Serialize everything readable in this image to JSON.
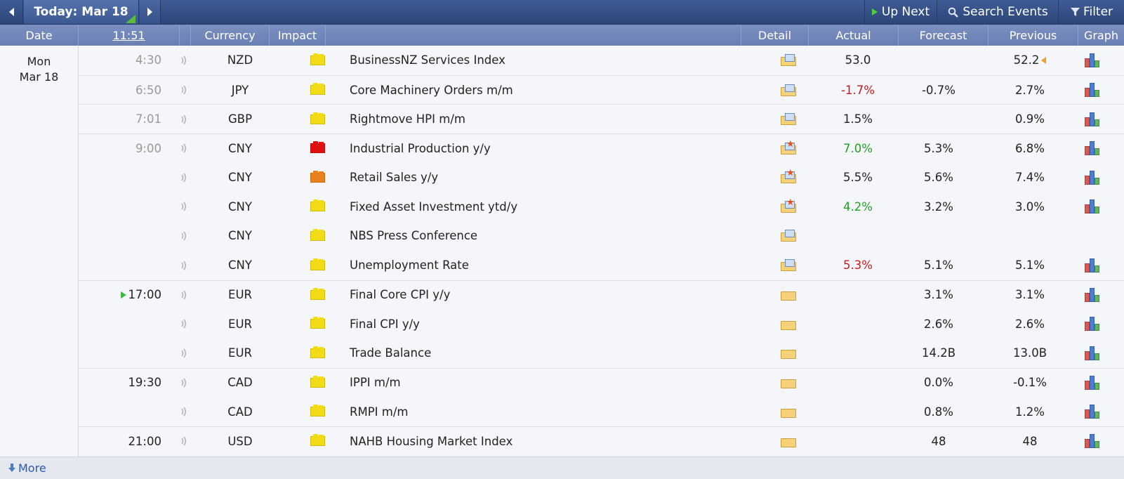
{
  "toolbar": {
    "today_label": "Today: Mar 18",
    "up_next_label": "Up Next",
    "search_label": "Search Events",
    "filter_label": "Filter"
  },
  "header": {
    "date": "Date",
    "time": "11:51",
    "currency": "Currency",
    "impact": "Impact",
    "detail": "Detail",
    "actual": "Actual",
    "forecast": "Forecast",
    "previous": "Previous",
    "graph": "Graph"
  },
  "date_cell": {
    "weekday": "Mon",
    "day": "Mar 18"
  },
  "impact_colors": {
    "low": "#f2dc17",
    "medium": "#e8801e",
    "high": "#e01010"
  },
  "rows": [
    {
      "time": "4:30",
      "currency": "NZD",
      "impact": "low",
      "event": "BusinessNZ Services Index",
      "detail": "folder-doc-icon",
      "actual": "53.0",
      "actual_color": "",
      "forecast": "",
      "previous": "52.2",
      "graph": true
    },
    {
      "time": "6:50",
      "currency": "JPY",
      "impact": "low",
      "event": "Core Machinery Orders m/m",
      "detail": "folder-doc-icon",
      "actual": "-1.7%",
      "actual_color": "red",
      "forecast": "-0.7%",
      "previous": "2.7%",
      "graph": true
    },
    {
      "time": "7:01",
      "currency": "GBP",
      "impact": "low",
      "event": "Rightmove HPI m/m",
      "detail": "folder-doc-icon",
      "actual": "1.5%",
      "actual_color": "",
      "forecast": "",
      "previous": "0.9%",
      "graph": true
    },
    {
      "time": "9:00",
      "currency": "CNY",
      "impact": "high",
      "event": "Industrial Production y/y",
      "detail": "folder-star-icon",
      "actual": "7.0%",
      "actual_color": "green",
      "forecast": "5.3%",
      "previous": "6.8%",
      "graph": true
    },
    {
      "time": "",
      "currency": "CNY",
      "impact": "medium",
      "event": "Retail Sales y/y",
      "detail": "folder-star-icon",
      "actual": "5.5%",
      "actual_color": "",
      "forecast": "5.6%",
      "previous": "7.4%",
      "graph": true
    },
    {
      "time": "",
      "currency": "CNY",
      "impact": "low",
      "event": "Fixed Asset Investment ytd/y",
      "detail": "folder-star-icon",
      "actual": "4.2%",
      "actual_color": "green",
      "forecast": "3.2%",
      "previous": "3.0%",
      "graph": true
    },
    {
      "time": "",
      "currency": "CNY",
      "impact": "low",
      "event": "NBS Press Conference",
      "detail": "folder-doc-icon",
      "actual": "",
      "actual_color": "",
      "forecast": "",
      "previous": "",
      "graph": false
    },
    {
      "time": "",
      "currency": "CNY",
      "impact": "low",
      "event": "Unemployment Rate",
      "detail": "folder-doc-icon",
      "actual": "5.3%",
      "actual_color": "red",
      "forecast": "5.1%",
      "previous": "5.1%",
      "graph": true
    },
    {
      "time": "17:00",
      "currency": "EUR",
      "impact": "low",
      "event": "Final Core CPI y/y",
      "detail": "folder-icon",
      "actual": "",
      "actual_color": "",
      "forecast": "3.1%",
      "previous": "3.1%",
      "graph": true
    },
    {
      "time": "",
      "currency": "EUR",
      "impact": "low",
      "event": "Final CPI y/y",
      "detail": "folder-icon",
      "actual": "",
      "actual_color": "",
      "forecast": "2.6%",
      "previous": "2.6%",
      "graph": true
    },
    {
      "time": "",
      "currency": "EUR",
      "impact": "low",
      "event": "Trade Balance",
      "detail": "folder-icon",
      "actual": "",
      "actual_color": "",
      "forecast": "14.2B",
      "previous": "13.0B",
      "graph": true
    },
    {
      "time": "19:30",
      "currency": "CAD",
      "impact": "low",
      "event": "IPPI m/m",
      "detail": "folder-icon",
      "actual": "",
      "actual_color": "",
      "forecast": "0.0%",
      "previous": "-0.1%",
      "graph": true
    },
    {
      "time": "",
      "currency": "CAD",
      "impact": "low",
      "event": "RMPI m/m",
      "detail": "folder-icon",
      "actual": "",
      "actual_color": "",
      "forecast": "0.8%",
      "previous": "1.2%",
      "graph": true
    },
    {
      "time": "21:00",
      "currency": "USD",
      "impact": "low",
      "event": "NAHB Housing Market Index",
      "detail": "folder-icon",
      "actual": "",
      "actual_color": "",
      "forecast": "48",
      "previous": "48",
      "graph": true
    }
  ],
  "footer": {
    "more_label": "More"
  }
}
